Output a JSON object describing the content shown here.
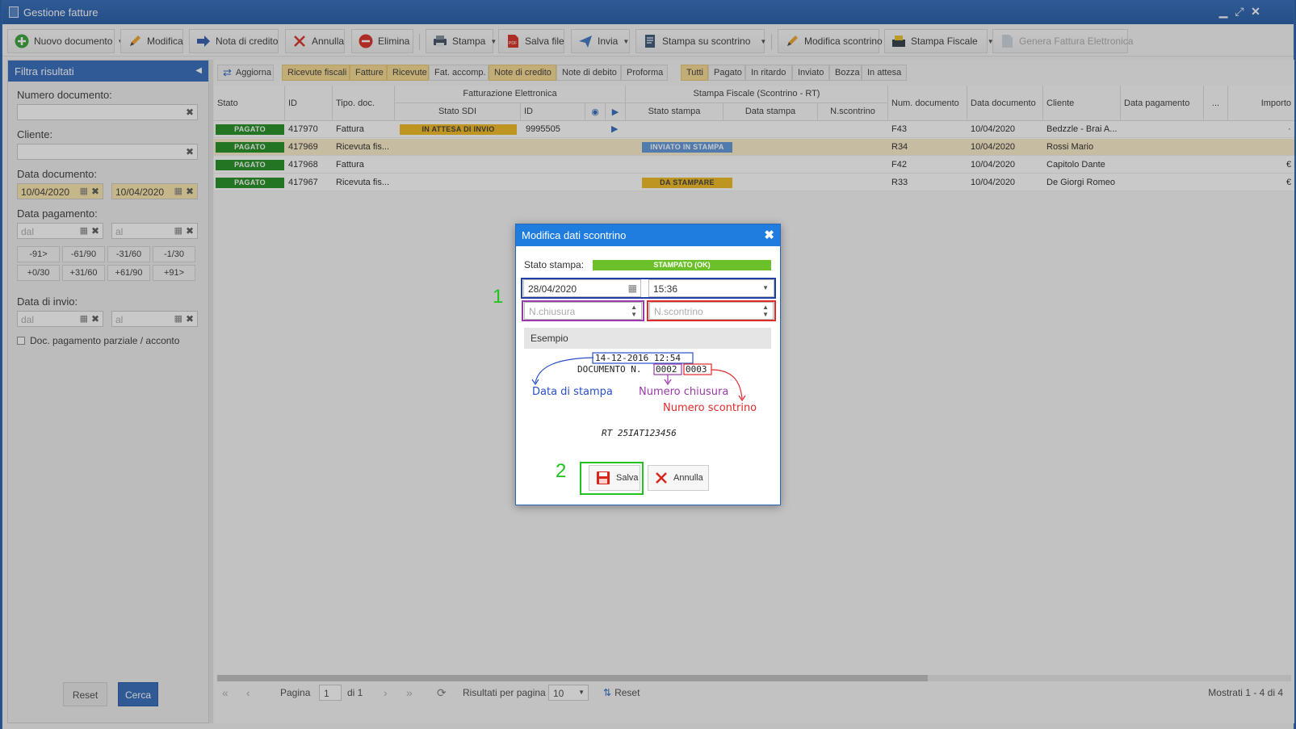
{
  "window": {
    "title": "Gestione fatture"
  },
  "toolbar": {
    "nuovo": "Nuovo documento",
    "modifica": "Modifica",
    "nota_credito": "Nota di credito",
    "annulla": "Annulla",
    "elimina": "Elimina",
    "stampa": "Stampa",
    "salva_file": "Salva file",
    "invia": "Invia",
    "stampa_scontrino": "Stampa su scontrino",
    "modifica_scontrino": "Modifica scontrino",
    "stampa_fiscale": "Stampa Fiscale",
    "genera_fe": "Genera Fattura Elettronica"
  },
  "sidebar": {
    "title": "Filtra risultati",
    "numero_label": "Numero documento:",
    "cliente_label": "Cliente:",
    "data_doc_label": "Data documento:",
    "data_doc_from": "10/04/2020",
    "data_doc_to": "10/04/2020",
    "data_pag_label": "Data pagamento:",
    "ph_dal": "dal",
    "ph_al": "al",
    "quick": [
      "-91>",
      "-61/90",
      "-31/60",
      "-1/30",
      "+0/30",
      "+31/60",
      "+61/90",
      "+91>"
    ],
    "data_invio_label": "Data di invio:",
    "parziale": "Doc. pagamento parziale / acconto",
    "reset": "Reset",
    "cerca": "Cerca"
  },
  "filters": {
    "aggiorna": "Aggiorna",
    "types": [
      "Ricevute fiscali",
      "Fatture",
      "Ricevute",
      "Fat. accomp.",
      "Note di credito",
      "Note di debito",
      "Proforma"
    ],
    "states": [
      "Tutti",
      "Pagato",
      "In ritardo",
      "Inviato",
      "Bozza",
      "In attesa"
    ]
  },
  "grid": {
    "headers": {
      "stato": "Stato",
      "id": "ID",
      "tipo": "Tipo. doc.",
      "fe": "Fatturazione Elettronica",
      "stato_sdi": "Stato SDI",
      "fe_id": "ID",
      "sf": "Stampa Fiscale (Scontrino - RT)",
      "stato_stampa": "Stato stampa",
      "data_stampa": "Data stampa",
      "n_scontrino": "N.scontrino",
      "num_doc": "Num. documento",
      "data_doc": "Data documento",
      "cliente": "Cliente",
      "data_pag": "Data pagamento",
      "more": "...",
      "importo": "Importo"
    },
    "rows": [
      {
        "stato": "PAGATO",
        "id": "417970",
        "tipo": "Fattura",
        "sdi": "IN ATTESA DI INVIO",
        "fe_id": "9995505",
        "stampa": "",
        "num": "F43",
        "data": "10/04/2020",
        "cliente": "Bedzzle - Brai A...",
        "imp": "·"
      },
      {
        "stato": "PAGATO",
        "id": "417969",
        "tipo": "Ricevuta fis...",
        "sdi": "",
        "fe_id": "",
        "stampa": "INVIATO IN STAMPA",
        "num": "R34",
        "data": "10/04/2020",
        "cliente": "Rossi Mario",
        "imp": ""
      },
      {
        "stato": "PAGATO",
        "id": "417968",
        "tipo": "Fattura",
        "sdi": "",
        "fe_id": "",
        "stampa": "",
        "num": "F42",
        "data": "10/04/2020",
        "cliente": "Capitolo Dante",
        "imp": "€"
      },
      {
        "stato": "PAGATO",
        "id": "417967",
        "tipo": "Ricevuta fis...",
        "sdi": "",
        "fe_id": "",
        "stampa": "DA STAMPARE",
        "num": "R33",
        "data": "10/04/2020",
        "cliente": "De Giorgi Romeo",
        "imp": "€"
      }
    ]
  },
  "pager": {
    "pagina": "Pagina",
    "page": "1",
    "di": "di 1",
    "per_page_label": "Risultati per pagina",
    "per_page": "10",
    "reset": "Reset",
    "summary": "Mostrati 1 - 4 di 4"
  },
  "dialog": {
    "title": "Modifica dati scontrino",
    "stato_label": "Stato stampa:",
    "stato_value": "STAMPATO (OK)",
    "date": "28/04/2020",
    "time": "15:36",
    "ph_chiusura": "N.chiusura",
    "ph_scontrino": "N.scontrino",
    "esempio": "Esempio",
    "receipt_line1": "14-12-2016 12:54",
    "receipt_doc": "DOCUMENTO N.",
    "receipt_n1": "0002",
    "receipt_n2": "0003",
    "label_data": "Data di stampa",
    "label_chiusura": "Numero chiusura",
    "label_scontrino": "Numero scontrino",
    "receipt_rt": "RT 25IAT123456",
    "salva": "Salva",
    "annulla": "Annulla"
  },
  "annotations": {
    "one": "1",
    "two": "2"
  },
  "colors": {
    "accent": "#2a66b8",
    "dialog_header": "#1f7de0",
    "annot_green": "#21c321",
    "ok_green": "#6cc02a"
  }
}
